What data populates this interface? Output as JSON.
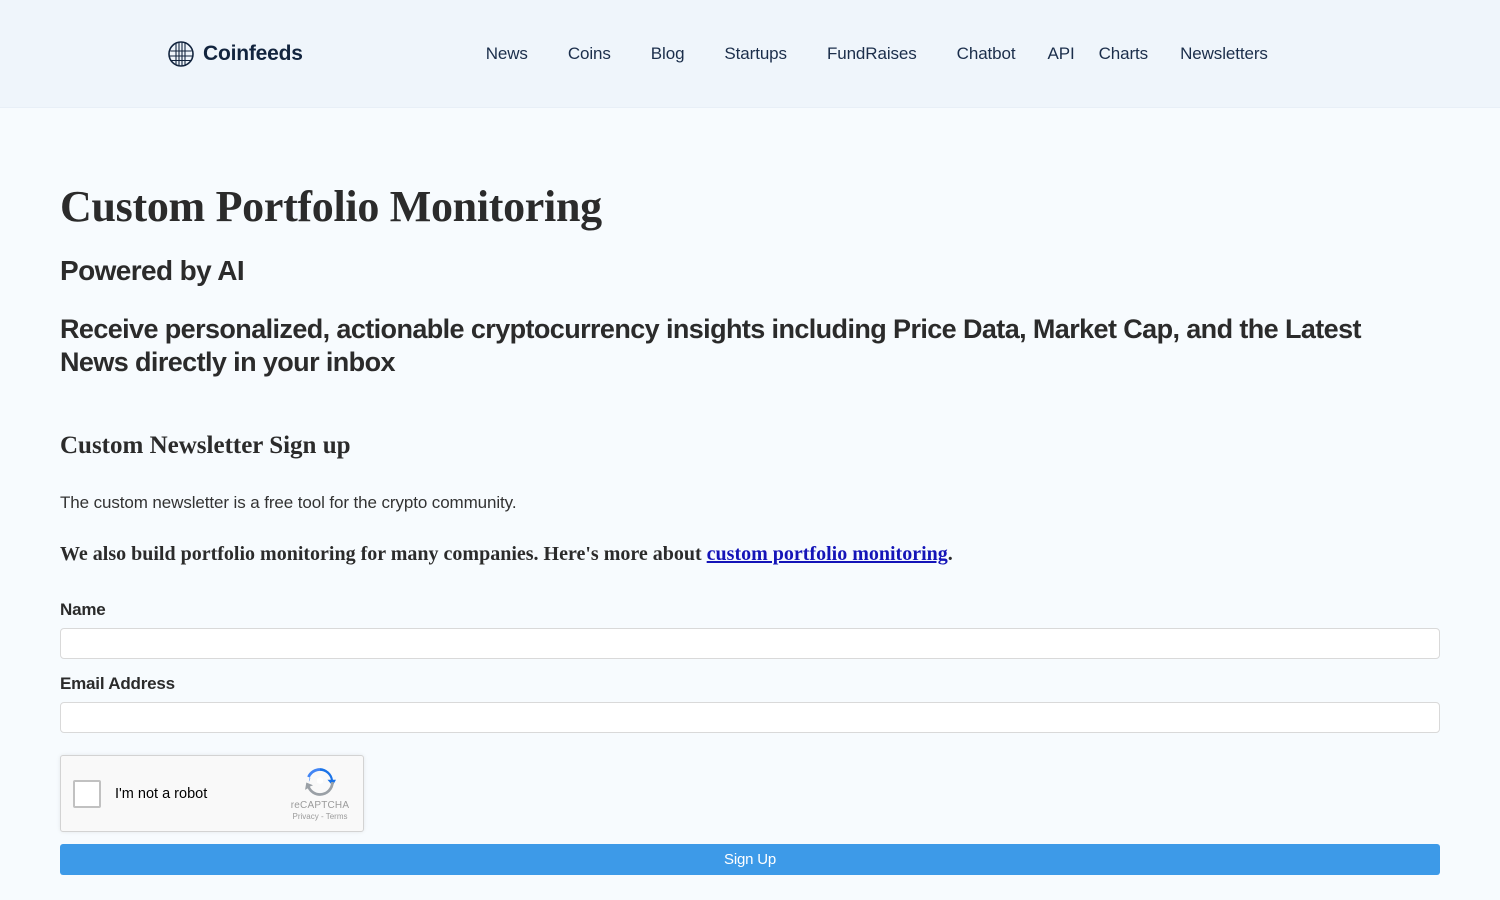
{
  "header": {
    "brand": {
      "name": "Coinfeeds",
      "logo_icon": "globe-circle-icon"
    },
    "nav": [
      {
        "label": "News"
      },
      {
        "label": "Coins"
      },
      {
        "label": "Blog"
      },
      {
        "label": "Startups"
      },
      {
        "label": "FundRaises"
      },
      {
        "label": "Chatbot"
      },
      {
        "label": "API"
      },
      {
        "label": "Charts"
      },
      {
        "label": "Newsletters"
      }
    ]
  },
  "main": {
    "title": "Custom Portfolio Monitoring",
    "subtitle": "Powered by AI",
    "lede": "Receive personalized, actionable cryptocurrency insights including Price Data, Market Cap, and the Latest News directly in your inbox",
    "section_title": "Custom Newsletter Sign up",
    "body_text": "The custom newsletter is a free tool for the crypto community.",
    "emphasis_prefix": "We also build portfolio monitoring for many companies. Here's more about ",
    "emphasis_link": "custom portfolio monitoring",
    "emphasis_suffix": "."
  },
  "form": {
    "name_label": "Name",
    "name_value": "",
    "name_placeholder": "",
    "email_label": "Email Address",
    "email_value": "",
    "email_placeholder": "",
    "submit_label": "Sign Up"
  },
  "recaptcha": {
    "checkbox_label": "I'm not a robot",
    "brand_name": "reCAPTCHA",
    "privacy_label": "Privacy",
    "separator": "-",
    "terms_label": "Terms",
    "logo_icon": "recaptcha-logo-icon"
  },
  "colors": {
    "header_bg": "#eff5fb",
    "page_bg": "#f7fbfe",
    "brand_text": "#12243e",
    "nav_text": "#1b2e4b",
    "heading_text": "#2b2b2b",
    "link": "#1414b8",
    "button_bg": "#3d9ae8",
    "button_text": "#ffffff",
    "input_border": "#d9d9d9"
  }
}
